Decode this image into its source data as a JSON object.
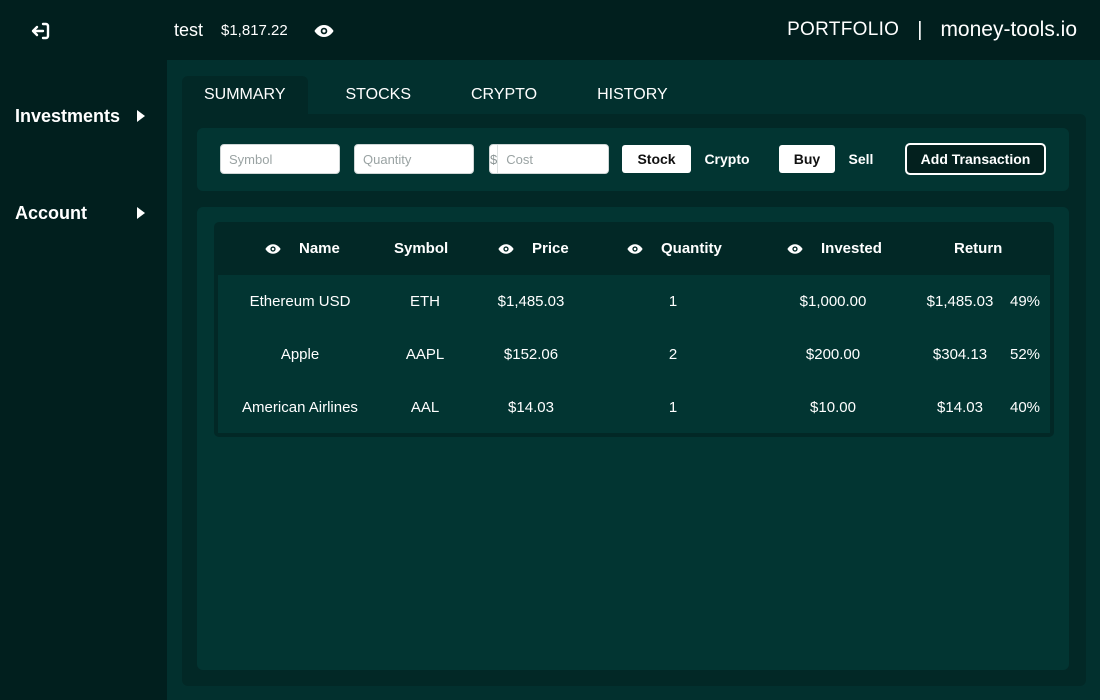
{
  "header": {
    "user_name": "test",
    "user_total": "$1,817.22",
    "brand_section": "PORTFOLIO",
    "brand_separator": "|",
    "brand_site": "money-tools.io"
  },
  "sidebar": {
    "items": [
      {
        "label": "Investments"
      },
      {
        "label": "Account"
      }
    ]
  },
  "tabs": [
    {
      "label": "SUMMARY",
      "active": true
    },
    {
      "label": "STOCKS",
      "active": false
    },
    {
      "label": "CRYPTO",
      "active": false
    },
    {
      "label": "HISTORY",
      "active": false
    }
  ],
  "form": {
    "symbol_placeholder": "Symbol",
    "quantity_placeholder": "Quantity",
    "cost_prefix": "$",
    "cost_placeholder": "Cost",
    "asset_type": {
      "options": [
        "Stock",
        "Crypto"
      ],
      "selected": "Stock"
    },
    "side": {
      "options": [
        "Buy",
        "Sell"
      ],
      "selected": "Buy"
    },
    "add_label": "Add Transaction"
  },
  "table": {
    "columns": [
      "Name",
      "Symbol",
      "Price",
      "Quantity",
      "Invested",
      "Return"
    ],
    "rows": [
      {
        "name": "Ethereum USD",
        "symbol": "ETH",
        "price": "$1,485.03",
        "quantity": "1",
        "invested": "$1,000.00",
        "return_value": "$1,485.03",
        "return_pct": "49%"
      },
      {
        "name": "Apple",
        "symbol": "AAPL",
        "price": "$152.06",
        "quantity": "2",
        "invested": "$200.00",
        "return_value": "$304.13",
        "return_pct": "52%"
      },
      {
        "name": "American Airlines",
        "symbol": "AAL",
        "price": "$14.03",
        "quantity": "1",
        "invested": "$10.00",
        "return_value": "$14.03",
        "return_pct": "40%"
      }
    ]
  },
  "colors": {
    "background": "#022a28",
    "topbar": "#011f1e",
    "panel": "#022826",
    "card": "#023532",
    "text": "#ffffff"
  }
}
